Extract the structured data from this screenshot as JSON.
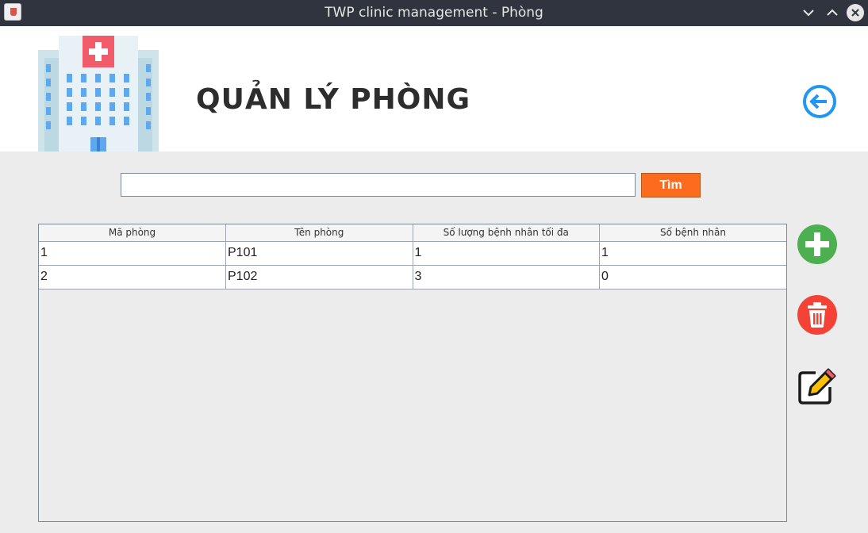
{
  "window": {
    "title": "TWP clinic management - Phòng"
  },
  "header": {
    "title": "QUẢN LÝ PHÒNG"
  },
  "search": {
    "value": "",
    "button_label": "Tìm"
  },
  "table": {
    "columns": [
      "Mã phòng",
      "Tên phòng",
      "Số lượng bệnh nhân tối đa",
      "Số bệnh nhân"
    ],
    "rows": [
      [
        "1",
        "P101",
        "1",
        "1"
      ],
      [
        "2",
        "P102",
        "3",
        "0"
      ]
    ]
  },
  "icons": {
    "back": "arrow-left-circle-icon",
    "add": "plus-circle-icon",
    "delete": "trash-icon",
    "edit": "edit-pencil-icon",
    "hospital": "hospital-building-icon"
  },
  "colors": {
    "accent_orange": "#fd6b1f",
    "add_green": "#4caf50",
    "delete_red": "#f44336",
    "back_blue": "#2196f3"
  }
}
